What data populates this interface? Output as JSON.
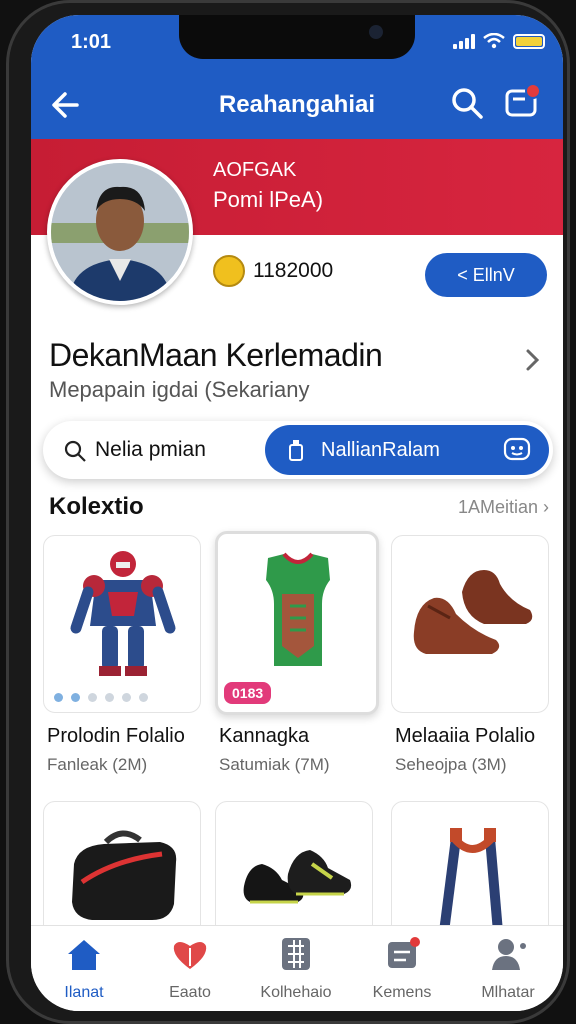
{
  "status": {
    "time": "1:01"
  },
  "header": {
    "title": "Reahangahiai"
  },
  "profile": {
    "banner_line1": "AOFGAK",
    "banner_line2": "Pomi lPeA)",
    "coins": "1182000",
    "follow_label": "< EllnV",
    "name": "DekanMaan Kerlemadin",
    "subtitle": "Mepapain igdai (Sekariany"
  },
  "toggle": {
    "left_label": "Nelia pmian",
    "right_label": "NallianRalam"
  },
  "collection": {
    "title": "Kolextio",
    "see_all": "1AMeitian",
    "items": [
      {
        "title": "Prolodin Folalio",
        "subtitle": "Fanleak (2M)",
        "icon": "armor-figure-icon"
      },
      {
        "title": "Kannagka",
        "subtitle": "Satumiak (7M)",
        "icon": "green-jersey-icon",
        "badge": "0183"
      },
      {
        "title": "Melaaiia Polalio",
        "subtitle": "Seheojpa (3M)",
        "icon": "leather-shoes-icon"
      },
      {
        "title": "",
        "subtitle": "",
        "icon": "gym-bag-icon"
      },
      {
        "title": "",
        "subtitle": "",
        "icon": "football-boots-icon"
      },
      {
        "title": "",
        "subtitle": "",
        "icon": "suspenders-icon"
      }
    ]
  },
  "bottom_nav": [
    {
      "label": "Ilanat",
      "icon": "home-icon",
      "active": true
    },
    {
      "label": "Eaato",
      "icon": "heart-icon",
      "active": false
    },
    {
      "label": "Kolhehaio",
      "icon": "grid-icon",
      "active": false
    },
    {
      "label": "Kemens",
      "icon": "inbox-icon",
      "active": false
    },
    {
      "label": "Mlhatar",
      "icon": "profile-icon",
      "active": false
    }
  ],
  "colors": {
    "primary": "#1f5cc4",
    "banner": "#c61d34",
    "badge": "#e23a7a",
    "coin": "#f0c01e"
  }
}
